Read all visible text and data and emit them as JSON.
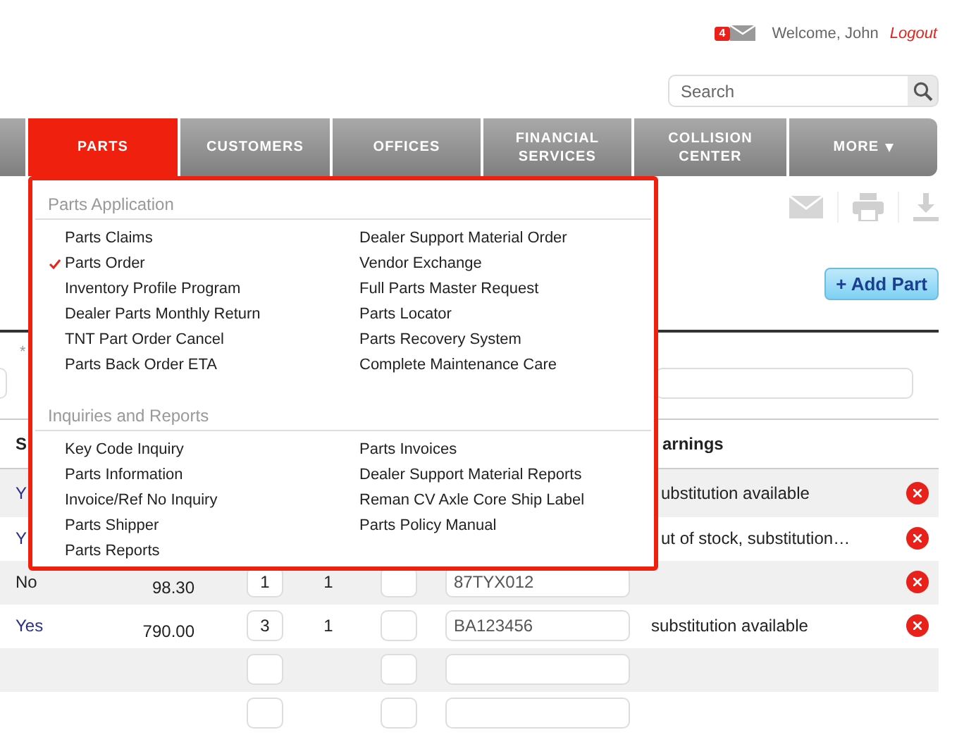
{
  "header": {
    "notification_count": "4",
    "welcome": "Welcome, John",
    "logout": "Logout"
  },
  "search": {
    "placeholder": "Search"
  },
  "nav": [
    {
      "label": "PARTS",
      "selected": true
    },
    {
      "label": "CUSTOMERS",
      "selected": false
    },
    {
      "label": "OFFICES",
      "selected": false
    },
    {
      "label": "FINANCIAL SERVICES",
      "selected": false
    },
    {
      "label": "COLLISION CENTER",
      "selected": false
    },
    {
      "label": "MORE",
      "selected": false,
      "dropdown": true
    }
  ],
  "menu": {
    "sections": [
      {
        "title": "Parts Application",
        "left": [
          {
            "label": "Parts Claims",
            "checked": false
          },
          {
            "label": "Parts Order",
            "checked": true
          },
          {
            "label": "Inventory Profile Program",
            "checked": false
          },
          {
            "label": "Dealer Parts Monthly Return",
            "checked": false
          },
          {
            "label": "TNT Part Order Cancel",
            "checked": false
          },
          {
            "label": "Parts Back Order ETA",
            "checked": false
          }
        ],
        "right": [
          {
            "label": "Dealer Support Material Order",
            "checked": false
          },
          {
            "label": "Vendor Exchange",
            "checked": false
          },
          {
            "label": "Full Parts Master Request",
            "checked": false
          },
          {
            "label": "Parts Locator",
            "checked": false
          },
          {
            "label": "Parts Recovery System",
            "checked": false
          },
          {
            "label": "Complete Maintenance Care",
            "checked": false
          }
        ]
      },
      {
        "title": "Inquiries and Reports",
        "left": [
          {
            "label": "Key Code Inquiry",
            "checked": false
          },
          {
            "label": "Parts Information",
            "checked": false
          },
          {
            "label": "Invoice/Ref No Inquiry",
            "checked": false
          },
          {
            "label": "Parts Shipper",
            "checked": false
          },
          {
            "label": "Parts Reports",
            "checked": false
          }
        ],
        "right": [
          {
            "label": "Parts Invoices",
            "checked": false
          },
          {
            "label": "Dealer Support Material Reports",
            "checked": false
          },
          {
            "label": "Reman CV Axle Core Ship Label",
            "checked": false
          },
          {
            "label": "Parts Policy Manual",
            "checked": false
          }
        ]
      }
    ]
  },
  "add_part": "+ Add Part",
  "required_mark": "*",
  "table": {
    "columns": [
      "S",
      "arnings"
    ],
    "rows": [
      {
        "status": "Y",
        "link": true,
        "warning": "ubstitution available",
        "removable": true
      },
      {
        "status": "Y",
        "link": true,
        "warning": "ut of stock, substitution…",
        "removable": true
      },
      {
        "status": "No",
        "link": false,
        "price": "98.30",
        "qty": "1",
        "count": "1",
        "part": "87TYX012",
        "removable": true
      },
      {
        "status": "Yes",
        "link": true,
        "price": "790.00",
        "qty": "3",
        "count": "1",
        "part": "BA123456",
        "warning": "substitution available",
        "removable": true
      },
      {
        "removable": false
      },
      {
        "removable": false
      }
    ]
  }
}
